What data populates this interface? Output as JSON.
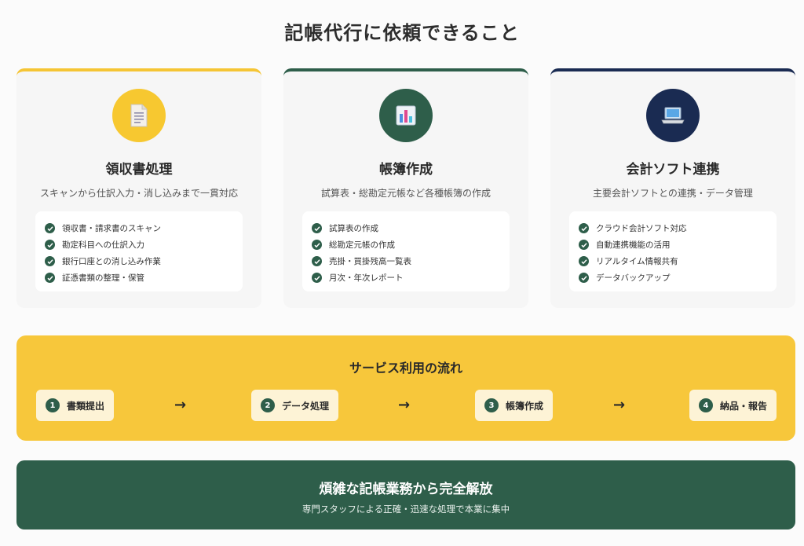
{
  "page": {
    "title": "記帳代行に依頼できること"
  },
  "cards": [
    {
      "icon": "document-icon",
      "accent": "#f5c535",
      "title": "領収書処理",
      "description": "スキャンから仕訳入力・消し込みまで一貫対応",
      "items": [
        "領収書・請求書のスキャン",
        "勘定科目への仕訳入力",
        "銀行口座との消し込み作業",
        "証憑書類の整理・保管"
      ]
    },
    {
      "icon": "chart-icon",
      "accent": "#2e5e4a",
      "title": "帳簿作成",
      "description": "試算表・総勘定元帳など各種帳簿の作成",
      "items": [
        "試算表の作成",
        "総勘定元帳の作成",
        "売掛・買掛残高一覧表",
        "月次・年次レポート"
      ]
    },
    {
      "icon": "laptop-icon",
      "accent": "#1a2b52",
      "title": "会計ソフト連携",
      "description": "主要会計ソフトとの連携・データ管理",
      "items": [
        "クラウド会計ソフト対応",
        "自動連携機能の活用",
        "リアルタイム情報共有",
        "データバックアップ"
      ]
    }
  ],
  "flow": {
    "title": "サービス利用の流れ",
    "steps": [
      {
        "num": "1",
        "label": "書類提出"
      },
      {
        "num": "2",
        "label": "データ処理"
      },
      {
        "num": "3",
        "label": "帳簿作成"
      },
      {
        "num": "4",
        "label": "納品・報告"
      }
    ],
    "arrow": "→"
  },
  "banner": {
    "title": "煩雑な記帳業務から完全解放",
    "subtitle": "専門スタッフによる正確・迅速な処理で本業に集中"
  },
  "colors": {
    "yellow": "#f7c73b",
    "green": "#2e5e4a",
    "navy": "#1a2b52"
  }
}
